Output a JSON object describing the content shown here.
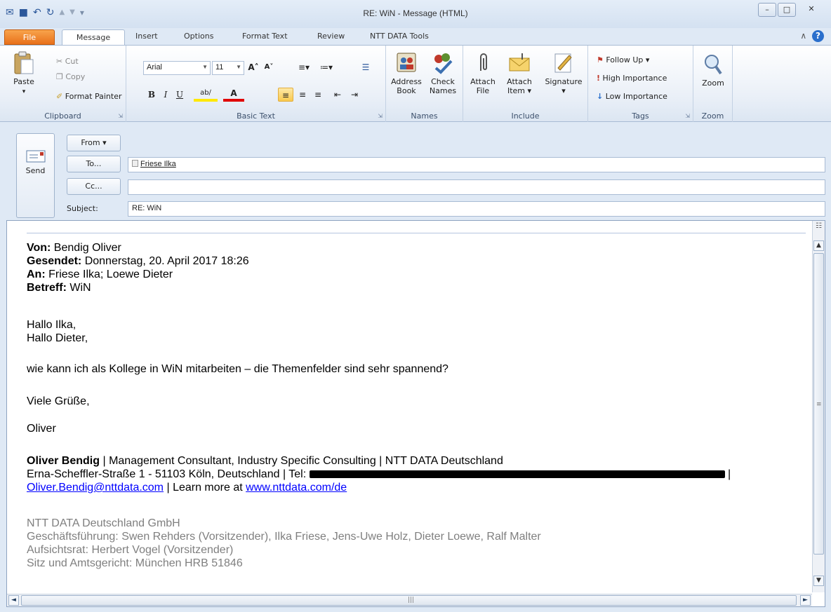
{
  "window": {
    "title": "RE: WiN  -  Message (HTML)",
    "minimize": "–",
    "maximize": "□",
    "close": "✕"
  },
  "quick_access": {
    "outlook_icon": "✉",
    "save_icon": "■",
    "undo_icon": "↶",
    "redo_icon": "↻",
    "up_icon": "▲",
    "down_icon": "▼",
    "customize_icon": "▾"
  },
  "tabs": [
    "File",
    "Message",
    "Insert",
    "Options",
    "Format Text",
    "Review",
    "NTT DATA Tools"
  ],
  "help": {
    "collapse_icon": "∧",
    "help_label": "?"
  },
  "ribbon": {
    "clipboard": {
      "label": "Clipboard",
      "paste": "Paste",
      "paste_arrow": "▾",
      "cut": "Cut",
      "copy": "Copy",
      "format_painter": "Format Painter"
    },
    "basic_text": {
      "label": "Basic Text",
      "font": "Arial",
      "size": "11",
      "grow": "A˄",
      "shrink": "A˅",
      "bold": "B",
      "italic": "I",
      "underline": "U",
      "highlight": "ab∕",
      "font_color": "A"
    },
    "names": {
      "label": "Names",
      "address_book": "Address\nBook",
      "check_names": "Check\nNames"
    },
    "include": {
      "label": "Include",
      "attach_file": "Attach\nFile",
      "attach_item": "Attach\nItem ▾",
      "signature": "Signature\n▾"
    },
    "tags": {
      "label": "Tags",
      "follow_up": "Follow Up ▾",
      "high_importance": "High Importance",
      "low_importance": "Low Importance"
    },
    "zoom": {
      "label": "Zoom",
      "zoom": "Zoom"
    }
  },
  "header": {
    "send": "Send",
    "from": "From ▾",
    "to": "To...",
    "cc": "Cc...",
    "subject_label": "Subject:",
    "to_value": "Friese Ilka",
    "cc_value": "",
    "subject_value": "RE: WiN"
  },
  "message": {
    "von_label": "Von:",
    "von": " Bendig Oliver",
    "gesendet_label": "Gesendet:",
    "gesendet": " Donnerstag, 20. April 2017 18:26",
    "an_label": "An:",
    "an": " Friese Ilka; Loewe Dieter",
    "betreff_label": "Betreff:",
    "betreff": " WiN",
    "greeting1": "Hallo Ilka,",
    "greeting2": "Hallo Dieter,",
    "body": "wie kann ich als Kollege in WiN mitarbeiten – die Themenfelder sind sehr spannend?",
    "closing": "Viele Grüße,",
    "name": "Oliver",
    "sig_name": "Oliver Bendig",
    "sig_title": " | Management Consultant, Industry Specific Consulting | NTT DATA Deutschland",
    "sig_address": "Erna-Scheffler-Straße 1 - 51103 Köln, Deutschland | Tel: ",
    "sig_pipe": " |",
    "sig_email": "Oliver.Bendig@nttdata.com",
    "sig_learn": " | Learn more at ",
    "sig_url": "www.nttdata.com/de",
    "company1": "NTT DATA Deutschland GmbH",
    "company2": "Geschäftsführung: Swen Rehders (Vorsitzender), Ilka Friese, Jens-Uwe Holz, Dieter Loewe, Ralf Malter",
    "company3": "Aufsichtsrat: Herbert Vogel (Vorsitzender)",
    "company4": "Sitz und Amtsgericht: München HRB 51846"
  },
  "scroll": {
    "grip_v": "≡",
    "grip_h": "|||",
    "up": "▲",
    "down": "▼",
    "left": "◄",
    "right": "►"
  }
}
